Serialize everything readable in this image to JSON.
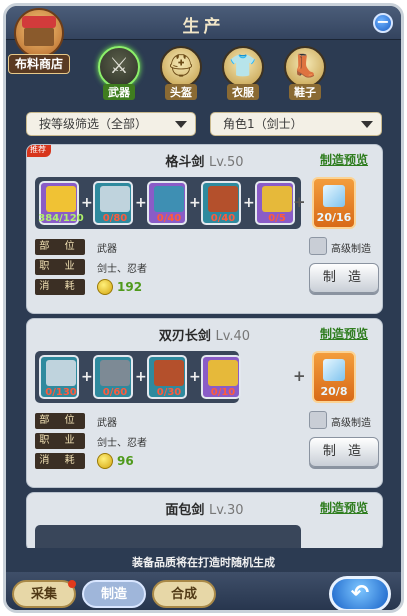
{
  "window": {
    "title": "生产",
    "minimize_icon": "−"
  },
  "shop": {
    "label": "布料商店"
  },
  "tabs": [
    {
      "label": "武器",
      "icon": "sword-icon",
      "glyph": "⚔",
      "active": true
    },
    {
      "label": "头盔",
      "icon": "helmet-icon",
      "glyph": "⛑",
      "active": false
    },
    {
      "label": "衣服",
      "icon": "clothes-icon",
      "glyph": "👕",
      "active": false
    },
    {
      "label": "鞋子",
      "icon": "shoes-icon",
      "glyph": "👢",
      "active": false
    }
  ],
  "filters": {
    "level": "按等级筛选（全部）",
    "role": "角色1（剑士）"
  },
  "labels": {
    "preview": "制造预览",
    "part": "部 位",
    "job": "职 业",
    "cost": "消 耗",
    "advanced": "高级制造",
    "make": "制 造",
    "hot": "推荐"
  },
  "recipes": [
    {
      "name": "格斗剑",
      "level": "Lv.50",
      "hot": true,
      "materials": [
        {
          "count": "384/120",
          "color": "#f0c234",
          "frame": "#8a5cc7"
        },
        {
          "count": "0/80",
          "color": "#bfd3dd",
          "frame": "#2f8a9e"
        },
        {
          "count": "0/40",
          "color": "#3e8fb3",
          "frame": "#8a5cc7"
        },
        {
          "count": "0/40",
          "color": "#b4502c",
          "frame": "#2f8a9e"
        },
        {
          "count": "0/5",
          "color": "#e6b93a",
          "frame": "#8a5cc7"
        }
      ],
      "result": {
        "count": "20/16"
      },
      "part": "武器",
      "job": "剑士、忍者",
      "cost": "192"
    },
    {
      "name": "双刃长剑",
      "level": "Lv.40",
      "hot": false,
      "materials": [
        {
          "count": "0/130",
          "color": "#bfd3dd",
          "frame": "#2f8a9e"
        },
        {
          "count": "0/60",
          "color": "#7d8a95",
          "frame": "#2f8a9e"
        },
        {
          "count": "0/30",
          "color": "#b4502c",
          "frame": "#2f8a9e"
        },
        {
          "count": "0/10",
          "color": "#e6b93a",
          "frame": "#8a5cc7"
        }
      ],
      "result": {
        "count": "20/8"
      },
      "part": "武器",
      "job": "剑士、忍者",
      "cost": "96"
    },
    {
      "name": "面包剑",
      "level": "Lv.30",
      "hot": false,
      "materials": [],
      "result": {
        "count": ""
      },
      "part": "",
      "job": "",
      "cost": ""
    }
  ],
  "notice": "装备品质将在打造时随机生成",
  "bottom_tabs": [
    {
      "label": "采集",
      "active": false
    },
    {
      "label": "制造",
      "active": true
    },
    {
      "label": "合成",
      "active": false
    }
  ],
  "back_icon": "↶"
}
